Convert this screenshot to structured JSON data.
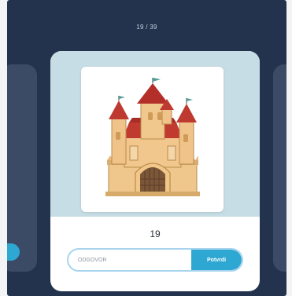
{
  "header": {
    "progress_label": "19 / 39"
  },
  "card": {
    "number_label": "19",
    "answer_placeholder": "ODGOVOR",
    "submit_label": "Potvrdi"
  },
  "colors": {
    "background": "#23334d",
    "card_top": "#c7dde6",
    "accent": "#2ea7d2"
  },
  "icons": {
    "main_image": "castle-icon"
  }
}
